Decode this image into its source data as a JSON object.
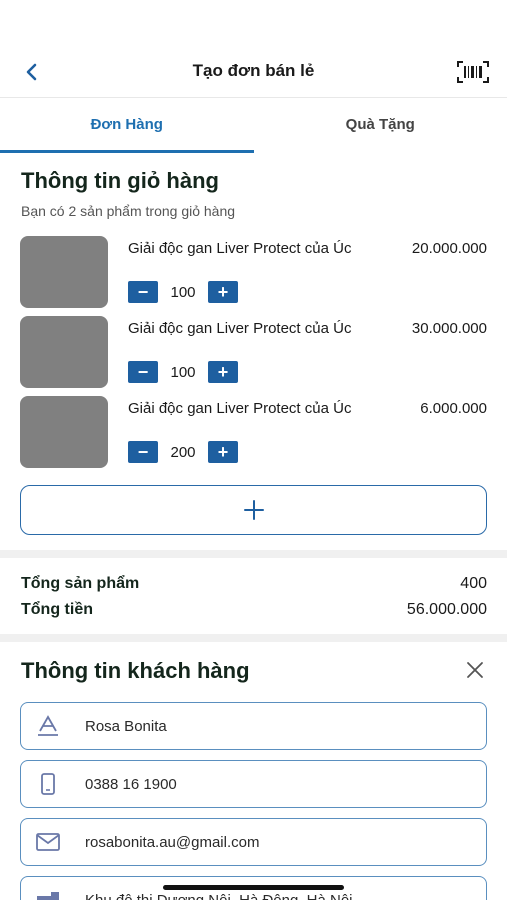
{
  "header": {
    "title": "Tạo đơn bán lẻ"
  },
  "tabs": [
    {
      "label": "Đơn Hàng",
      "active": true
    },
    {
      "label": "Quà Tặng",
      "active": false
    }
  ],
  "cart": {
    "title": "Thông tin giỏ hàng",
    "subtitle": "Bạn có 2 sản phẩm trong giỏ hàng",
    "items": [
      {
        "name": "Giải độc gan Liver Protect của Úc",
        "price": "20.000.000",
        "qty": "100"
      },
      {
        "name": "Giải độc gan Liver Protect của Úc",
        "price": "30.000.000",
        "qty": "100"
      },
      {
        "name": "Giải độc gan Liver Protect của Úc",
        "price": "6.000.000",
        "qty": "200"
      }
    ],
    "minus_symbol": "−",
    "plus_symbol": "+"
  },
  "summary": {
    "total_products_label": "Tổng sản phẩm",
    "total_products_value": "400",
    "total_amount_label": "Tổng tiền",
    "total_amount_value": "56.000.000"
  },
  "customer": {
    "title": "Thông tin khách hàng",
    "name": "Rosa Bonita",
    "phone": "0388 16 1900",
    "email": "rosabonita.au@gmail.com",
    "address": "Khu đô thị Dương Nội, Hà Đông, Hà Nội"
  },
  "colors": {
    "accent": "#1e6fb0",
    "button": "#1e5fa0",
    "field_border": "#5a8fbf",
    "thumb": "#808080"
  }
}
